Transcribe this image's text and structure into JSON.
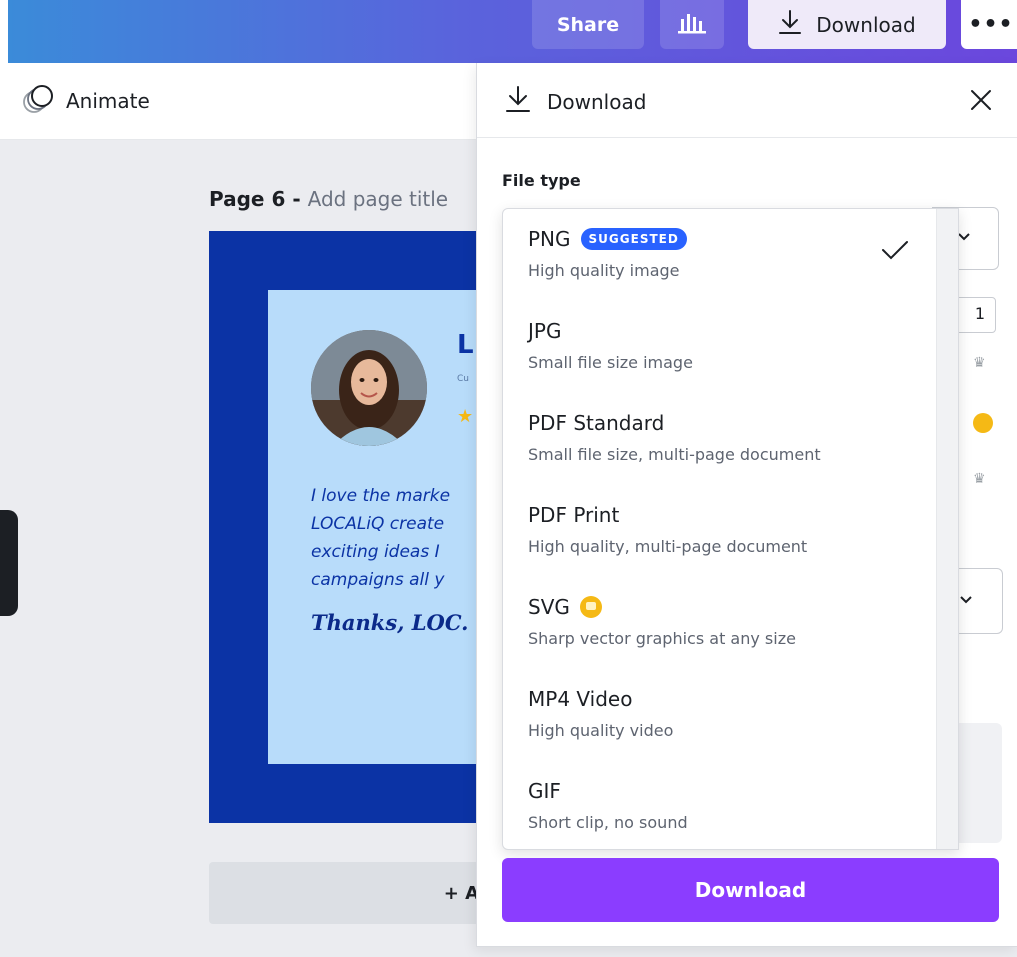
{
  "topbar": {
    "share_label": "Share",
    "stats_icon": "bar-chart-icon",
    "download_label": "Download",
    "download_icon": "download-icon",
    "more_label": "•••",
    "gradient_colors": [
      "#3b8bd9",
      "#6b47dd"
    ]
  },
  "toolbar": {
    "animate_label": "Animate",
    "animate_icon": "animate-circles-icon"
  },
  "canvas": {
    "page_label": "Page 6 -",
    "page_title_placeholder": "Add page title",
    "add_page_label": "+ A",
    "design": {
      "name_initial": "L",
      "role_text": "Cu",
      "star": "★",
      "quote_lines": "I love the marke\nLOCALiQ create\nexciting ideas I\ncampaigns all y",
      "thanks": "Thanks, LOC.",
      "colors": {
        "background": "#0b33a5",
        "card": "#b8dcfa",
        "accent": "#f5b915"
      }
    }
  },
  "download_panel": {
    "title": "Download",
    "title_icon": "download-icon",
    "close_icon": "close-icon",
    "file_type_label": "File type",
    "size_value": "1",
    "download_button_label": "Download",
    "button_color": "#8b3dff",
    "selected_file_type": "PNG",
    "file_types": [
      {
        "name": "PNG",
        "badge": "SUGGESTED",
        "description": "High quality image",
        "selected": true,
        "premium": false
      },
      {
        "name": "JPG",
        "badge": "",
        "description": "Small file size image",
        "selected": false,
        "premium": false
      },
      {
        "name": "PDF Standard",
        "badge": "",
        "description": "Small file size, multi-page document",
        "selected": false,
        "premium": false
      },
      {
        "name": "PDF Print",
        "badge": "",
        "description": "High quality, multi-page document",
        "selected": false,
        "premium": false
      },
      {
        "name": "SVG",
        "badge": "",
        "description": "Sharp vector graphics at any size",
        "selected": false,
        "premium": true
      },
      {
        "name": "MP4 Video",
        "badge": "",
        "description": "High quality video",
        "selected": false,
        "premium": false
      },
      {
        "name": "GIF",
        "badge": "",
        "description": "Short clip, no sound",
        "selected": false,
        "premium": false
      }
    ]
  }
}
